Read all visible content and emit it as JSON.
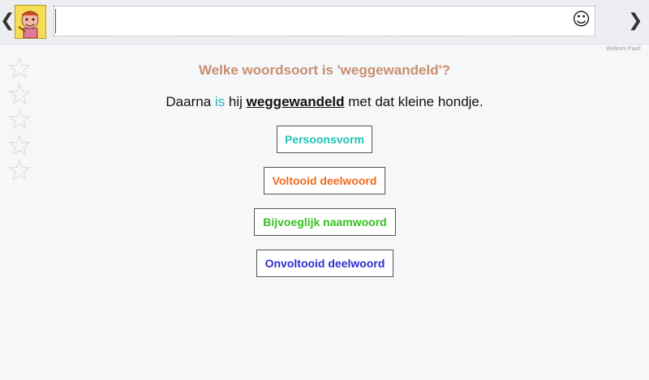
{
  "header": {
    "prev_glyph": "❮",
    "next_glyph": "❯",
    "logo_icon": "cartoon-character-logo",
    "input_value": "",
    "smiley_glyph": "☺"
  },
  "welcome_text": "Welkom Paul!",
  "stars": {
    "total": 5,
    "earned": 0,
    "icon": "star-outline"
  },
  "question": {
    "title": "Welke woordsoort is 'weggewandeld'?",
    "sentence_part1": "Daarna ",
    "sentence_highlight": "is",
    "sentence_part2": " hij ",
    "sentence_target": "weggewandeld",
    "sentence_part3": " met dat kleine hondje."
  },
  "options": [
    {
      "label": "Persoonsvorm",
      "color": "#1fc4b9"
    },
    {
      "label": "Voltooid deelwoord",
      "color": "#ee6a1c"
    },
    {
      "label": "Bijvoeglijk naamwoord",
      "color": "#33c11d"
    },
    {
      "label": "Onvoltooid deelwoord",
      "color": "#2a2fd0"
    }
  ],
  "colors": {
    "question": "#c88f6f",
    "highlight": "#27b6bf",
    "background": "#f6f7f9"
  }
}
